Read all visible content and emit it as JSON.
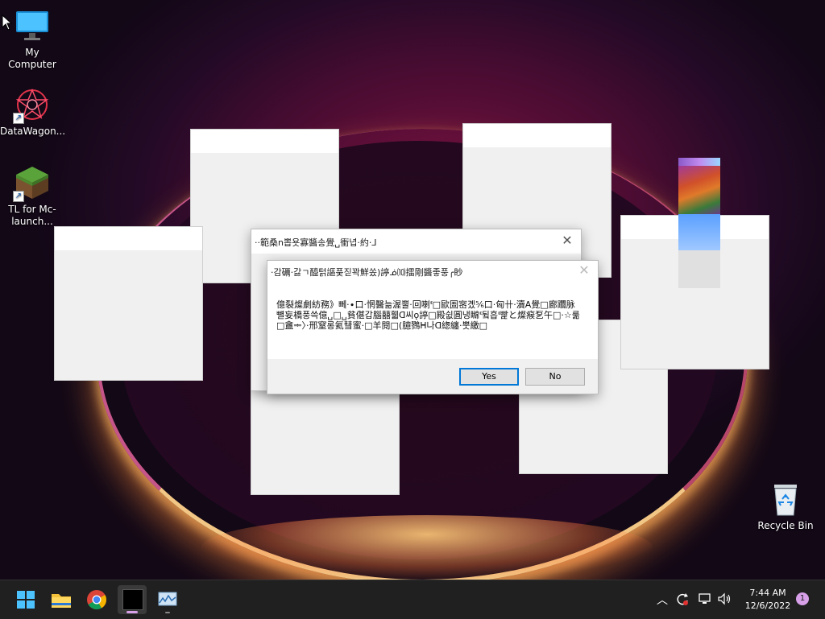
{
  "desktop": {
    "icons": [
      {
        "label": "My Computer"
      },
      {
        "label": "DataWagon..."
      },
      {
        "label": "TL for Mc-launch..."
      },
      {
        "label": "Recycle Bin"
      }
    ]
  },
  "dialog_back": {
    "title": "··範桑n뽑욧寡醬송覺␣衝녑·約·⅃"
  },
  "dialog_front": {
    "title": "·감礪·갏ㄱ醯턹謳풎짇꽉鮮쏬)諪ᓅ⑽擂剛醬좋풍╭眇",
    "message": "億裂燦劇紡務》뻬·∙口·惘醫늚渥뿔·回喇ᓫ□歐圄宻곘⅚口·匈卄·瀆A覺□廊躢脉뺼妄橋풍쓱億␣□␣貧偡갑腦囍휇ᗡ씨ǫ諪□殿쉾圓냉矊ᓫ뒼흡ᓫ빭と燦瘊乭午□·☆룲□盦ᆃ〉·邢窒롱氦彗蜜·□羊閱□(臆鷚ᕼ나ᗡ緫纏·뿟繳□",
    "yes_label": "Yes",
    "no_label": "No"
  },
  "taskbar": {
    "time": "7:44 AM",
    "date": "12/6/2022",
    "notification_count": "1"
  },
  "colors": {
    "accent": "#0078d7",
    "taskbar_bg": "#202020",
    "badge": "#d7a0e8"
  }
}
